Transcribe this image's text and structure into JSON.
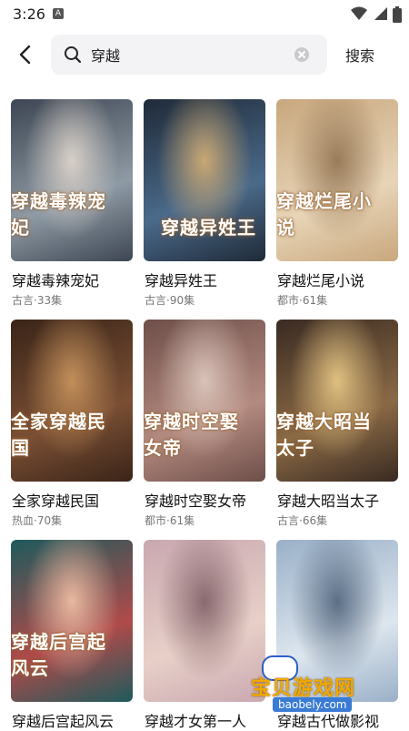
{
  "status_bar": {
    "time": "3:26",
    "notification_badge": "A"
  },
  "search": {
    "query": "穿越",
    "search_label": "搜索"
  },
  "colors": {
    "accent": "#f2a800",
    "watermark_blue": "#3a7bd5",
    "background": "#ffffff"
  },
  "cards": [
    {
      "title": "穿越毒辣宠妃",
      "meta": "古言·33集",
      "poster_text": "穿越毒辣宠妃",
      "palette": [
        "#3d4652",
        "#8e9aa5",
        "#d8d0c8"
      ]
    },
    {
      "title": "穿越异姓王",
      "meta": "古言·90集",
      "poster_text": "穿越异姓王",
      "palette": [
        "#1f2a38",
        "#4b6a8a",
        "#c9a875"
      ]
    },
    {
      "title": "穿越烂尾小说",
      "meta": "都市·61集",
      "poster_text": "穿越烂尾小说",
      "palette": [
        "#c8a77d",
        "#e8d5b8",
        "#9a7c5a"
      ]
    },
    {
      "title": "全家穿越民国",
      "meta": "热血·70集",
      "poster_text": "全家穿越民国",
      "palette": [
        "#3a2418",
        "#7a4f34",
        "#c28f5a"
      ]
    },
    {
      "title": "穿越时空娶女帝",
      "meta": "都市·61集",
      "poster_text": "穿越时空娶女帝",
      "palette": [
        "#6e4f49",
        "#b38a80",
        "#d9c2b8"
      ]
    },
    {
      "title": "穿越大昭当太子",
      "meta": "古言·66集",
      "poster_text": "穿越大昭当太子",
      "palette": [
        "#3a2a22",
        "#8a6a45",
        "#e0c080"
      ]
    },
    {
      "title": "穿越后宫起风云",
      "meta": "",
      "poster_text": "穿越后宫起风云",
      "palette": [
        "#1e5a5c",
        "#b04a4a",
        "#e8b8a0"
      ]
    },
    {
      "title": "穿越才女第一人",
      "meta": "",
      "poster_text": "",
      "palette": [
        "#c9a8b0",
        "#e8d0c8",
        "#8a6a70"
      ]
    },
    {
      "title": "穿越古代做影视",
      "meta": "",
      "poster_text": "",
      "palette": [
        "#9ab0c8",
        "#dde6ee",
        "#5c6f86"
      ]
    }
  ],
  "watermark": {
    "text": "宝贝游戏网",
    "url": "baobely.com"
  }
}
